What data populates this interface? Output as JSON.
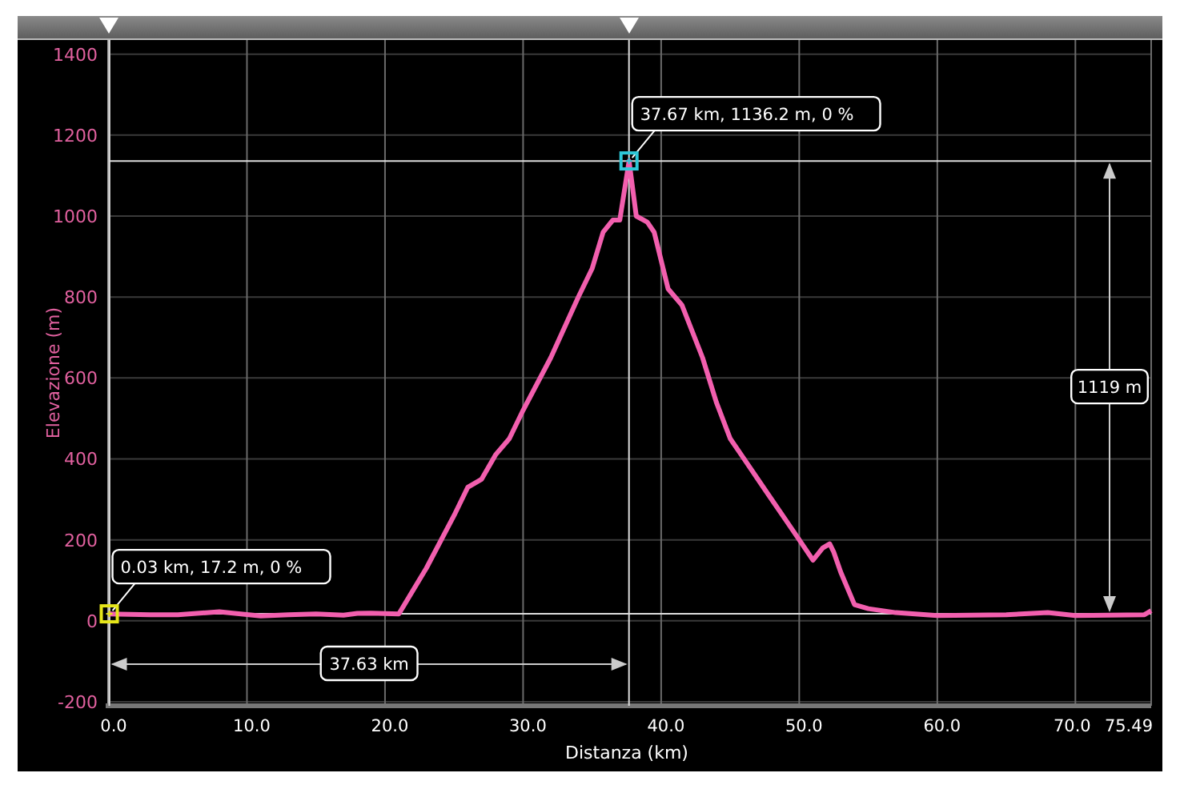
{
  "chart_data": {
    "type": "line",
    "xlabel": "Distanza (km)",
    "ylabel": "Elevazione (m)",
    "x": [
      0,
      3,
      5,
      8,
      11,
      13,
      15,
      17,
      18,
      19,
      21,
      23,
      25,
      26,
      27,
      28,
      29,
      30,
      32,
      34,
      35,
      35.8,
      36.5,
      37,
      37.67,
      38.2,
      39,
      39.5,
      40.5,
      41.5,
      43,
      44,
      45,
      46,
      47,
      48,
      49,
      50,
      51,
      51.7,
      52.2,
      52.5,
      53,
      54,
      55,
      57,
      60,
      65,
      68,
      70,
      75,
      75.49
    ],
    "grid": true,
    "series": [
      {
        "color": "#f25fae",
        "values": [
          17,
          15,
          15,
          22,
          12,
          15,
          17,
          14,
          18,
          19,
          17,
          130,
          260,
          330,
          350,
          410,
          450,
          520,
          650,
          800,
          870,
          960,
          990,
          990,
          1136,
          1000,
          985,
          960,
          820,
          780,
          650,
          540,
          450,
          400,
          350,
          300,
          250,
          200,
          150,
          180,
          190,
          170,
          120,
          40,
          30,
          20,
          13,
          15,
          20,
          13,
          15,
          25
        ]
      }
    ],
    "xlim": [
      0,
      75.49
    ],
    "ylim": [
      -210,
      1435
    ],
    "xticks": [
      {
        "value": 0,
        "label": "0.0"
      },
      {
        "value": 10,
        "label": "10.0"
      },
      {
        "value": 20,
        "label": "20.0"
      },
      {
        "value": 30,
        "label": "30.0"
      },
      {
        "value": 40,
        "label": "40.0"
      },
      {
        "value": 50,
        "label": "50.0"
      },
      {
        "value": 60,
        "label": "60.0"
      },
      {
        "value": 70,
        "label": "70.0"
      },
      {
        "value": 75.49,
        "label": "75.49"
      }
    ],
    "yticks": [
      -200,
      0,
      200,
      400,
      600,
      800,
      1000,
      1200,
      1400
    ],
    "annotations": [
      {
        "x": 0.03,
        "y": 17.2,
        "text": "0.03 km, 17.2 m, 0 %"
      },
      {
        "x": 37.67,
        "y": 1136.2,
        "text": "37.67 km, 1136.2 m, 0 %"
      }
    ]
  },
  "markers": [
    {
      "color": "#e6e61a"
    },
    {
      "color": "#2ec8d8"
    }
  ],
  "measurements": {
    "height": "1119 m",
    "distance": "37.63 km"
  }
}
